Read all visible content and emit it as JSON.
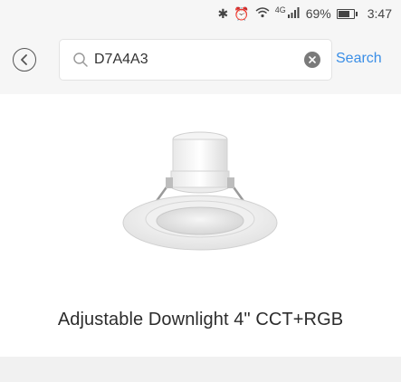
{
  "status_bar": {
    "bluetooth_icon": "bluetooth-icon",
    "alarm_icon": "alarm-icon",
    "wifi_icon": "wifi-icon",
    "network_label": "4G",
    "signal_icon": "signal-icon",
    "battery_percent": "69%",
    "battery_level": 0.69,
    "time": "3:47"
  },
  "header": {
    "back_icon": "chevron-left-icon",
    "search": {
      "value": "D7A4A3",
      "icon": "search-icon",
      "clear_icon": "clear-icon"
    },
    "search_button_label": "Search",
    "accent_color": "#3a8ee6"
  },
  "product": {
    "image": "recessed-downlight",
    "name": "Adjustable Downlight 4\" CCT+RGB"
  }
}
